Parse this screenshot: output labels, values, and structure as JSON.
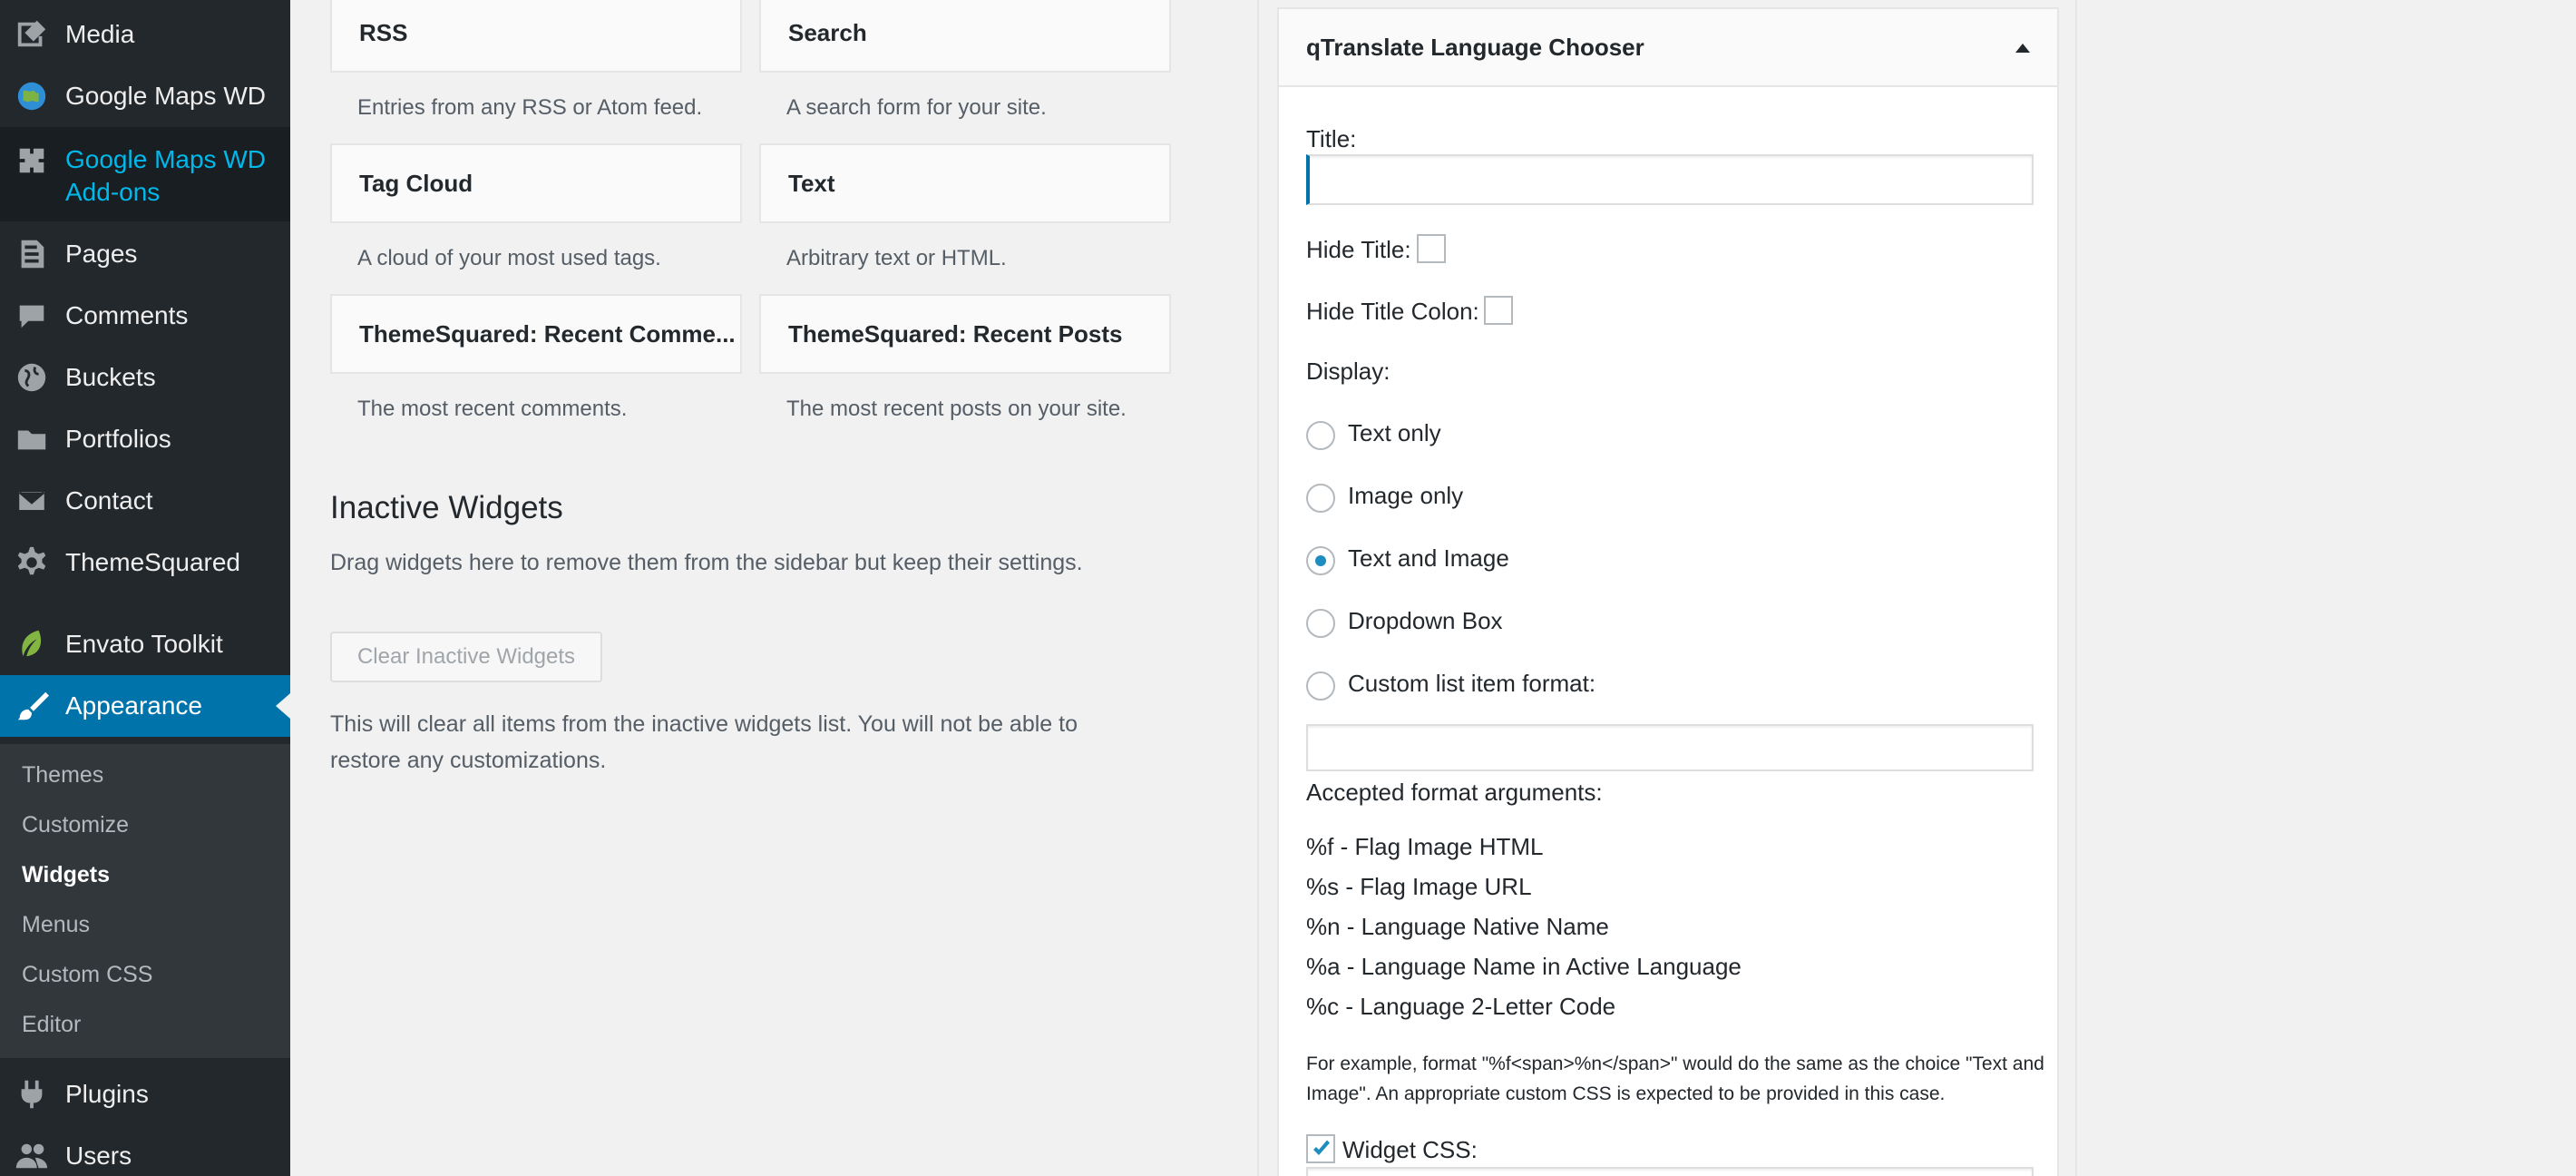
{
  "sidebar": {
    "items": [
      {
        "label": "Media",
        "icon": "media-icon"
      },
      {
        "label": "Google Maps WD",
        "icon": "globe-icon"
      },
      {
        "label": "Google Maps WD Add-ons",
        "icon": "plugin-icon"
      },
      {
        "label": "Pages",
        "icon": "pages-icon"
      },
      {
        "label": "Comments",
        "icon": "comments-icon"
      },
      {
        "label": "Buckets",
        "icon": "globe-icon"
      },
      {
        "label": "Portfolios",
        "icon": "folder-icon"
      },
      {
        "label": "Contact",
        "icon": "mail-icon"
      },
      {
        "label": "ThemeSquared",
        "icon": "gear-icon"
      },
      {
        "label": "Envato Toolkit",
        "icon": "leaf-icon"
      },
      {
        "label": "Appearance",
        "icon": "paintbrush-icon"
      },
      {
        "label": "Plugins",
        "icon": "plugin-icon"
      },
      {
        "label": "Users",
        "icon": "users-icon"
      }
    ],
    "submenu": [
      "Themes",
      "Customize",
      "Widgets",
      "Menus",
      "Custom CSS",
      "Editor"
    ],
    "current_submenu": "Widgets"
  },
  "widgets": [
    {
      "title": "RSS",
      "desc": "Entries from any RSS or Atom feed."
    },
    {
      "title": "Search",
      "desc": "A search form for your site."
    },
    {
      "title": "Tag Cloud",
      "desc": "A cloud of your most used tags."
    },
    {
      "title": "Text",
      "desc": "Arbitrary text or HTML."
    },
    {
      "title": "ThemeSquared: Recent Comme...",
      "desc": "The most recent comments."
    },
    {
      "title": "ThemeSquared: Recent Posts",
      "desc": "The most recent posts on your site."
    }
  ],
  "inactive": {
    "title": "Inactive Widgets",
    "desc": "Drag widgets here to remove them from the sidebar but keep their settings.",
    "clear_button": "Clear Inactive Widgets",
    "clear_desc": "This will clear all items from the inactive widgets list. You will not be able to restore any customizations."
  },
  "panel": {
    "title": "qTranslate Language Chooser",
    "title_label": "Title:",
    "title_value": "",
    "hide_title_label": "Hide Title:",
    "hide_title_colon_label": "Hide Title Colon:",
    "display_label": "Display:",
    "options": [
      "Text only",
      "Image only",
      "Text and Image",
      "Dropdown Box",
      "Custom list item format:"
    ],
    "selected_option": "Text and Image",
    "format_value": "",
    "args_label": "Accepted format arguments:",
    "args": [
      "%f - Flag Image HTML",
      "%s - Flag Image URL",
      "%n - Language Native Name",
      "%a - Language Name in Active Language",
      "%c - Language 2-Letter Code"
    ],
    "example_note": "For example, format \"%f<span>%n</span>\" would do the same as the choice \"Text and Image\".  An appropriate custom CSS is expected to be provided in this case.",
    "widget_css_label": "Widget CSS:",
    "widget_css_checked": true
  },
  "colors": {
    "sidebar_bg": "#23282d",
    "accent": "#0073aa",
    "active_link": "#00b9eb"
  }
}
